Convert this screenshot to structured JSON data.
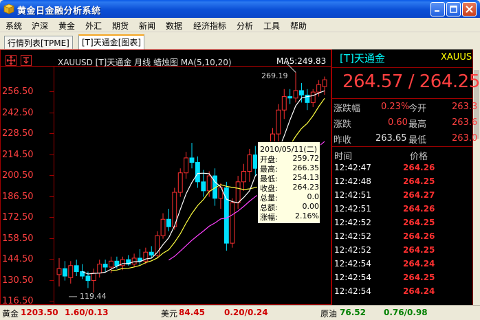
{
  "window": {
    "title": "黄金日金融分析系统"
  },
  "menu": [
    "系统",
    "沪深",
    "黄金",
    "外汇",
    "期货",
    "新闻",
    "数据",
    "经济指标",
    "分析",
    "工具",
    "帮助"
  ],
  "tabs": [
    {
      "label": "行情列表[TPME]",
      "active": false
    },
    {
      "label": "[T]天通金[图表]",
      "active": true
    }
  ],
  "chart": {
    "header": "XAUUSD [T]天通金  月线  蜡烛图  MA(5,10,20)",
    "ma5_label": "MA5:249.83",
    "high_label": "269.19",
    "low_label": "119.44",
    "colors": {
      "up": "#ff3030",
      "down": "#00e0ff",
      "ma5": "#ffffff",
      "ma10": "#ffff40",
      "ma20": "#ff40ff",
      "axis": "#a00000"
    },
    "y_labels": [
      "256.50",
      "242.50",
      "228.50",
      "214.50",
      "200.50",
      "186.50",
      "172.50",
      "158.50",
      "144.50",
      "130.50",
      "116.50"
    ]
  },
  "chart_data": {
    "type": "candlestick",
    "title": "XAUUSD [T]天通金 月线 蜡烛图 MA(5,10,20)",
    "ylim": [
      116.5,
      270
    ],
    "candles": [
      {
        "o": 134,
        "h": 145,
        "l": 126,
        "c": 138
      },
      {
        "o": 138,
        "h": 143,
        "l": 130,
        "c": 133
      },
      {
        "o": 132,
        "h": 143,
        "l": 128,
        "c": 140
      },
      {
        "o": 140,
        "h": 144,
        "l": 133,
        "c": 136
      },
      {
        "o": 136,
        "h": 141,
        "l": 131,
        "c": 133
      },
      {
        "o": 133,
        "h": 136,
        "l": 125,
        "c": 130
      },
      {
        "o": 130,
        "h": 138,
        "l": 122,
        "c": 135
      },
      {
        "o": 135,
        "h": 144,
        "l": 132,
        "c": 141
      },
      {
        "o": 141,
        "h": 144,
        "l": 136,
        "c": 139
      },
      {
        "o": 139,
        "h": 146,
        "l": 135,
        "c": 143
      },
      {
        "o": 143,
        "h": 146,
        "l": 138,
        "c": 140
      },
      {
        "o": 140,
        "h": 146,
        "l": 137,
        "c": 144
      },
      {
        "o": 144,
        "h": 147,
        "l": 140,
        "c": 141
      },
      {
        "o": 141,
        "h": 148,
        "l": 139,
        "c": 145
      },
      {
        "o": 145,
        "h": 151,
        "l": 140,
        "c": 143
      },
      {
        "o": 143,
        "h": 152,
        "l": 141,
        "c": 149
      },
      {
        "o": 149,
        "h": 153,
        "l": 145,
        "c": 147
      },
      {
        "o": 147,
        "h": 163,
        "l": 145,
        "c": 160
      },
      {
        "o": 160,
        "h": 175,
        "l": 158,
        "c": 171
      },
      {
        "o": 171,
        "h": 178,
        "l": 163,
        "c": 166
      },
      {
        "o": 166,
        "h": 192,
        "l": 164,
        "c": 189
      },
      {
        "o": 189,
        "h": 205,
        "l": 186,
        "c": 202
      },
      {
        "o": 202,
        "h": 216,
        "l": 198,
        "c": 212
      },
      {
        "o": 212,
        "h": 222,
        "l": 205,
        "c": 209
      },
      {
        "o": 209,
        "h": 213,
        "l": 192,
        "c": 196
      },
      {
        "o": 196,
        "h": 204,
        "l": 186,
        "c": 190
      },
      {
        "o": 190,
        "h": 203,
        "l": 186,
        "c": 200
      },
      {
        "o": 200,
        "h": 205,
        "l": 180,
        "c": 185
      },
      {
        "o": 185,
        "h": 195,
        "l": 178,
        "c": 192
      },
      {
        "o": 192,
        "h": 196,
        "l": 150,
        "c": 155
      },
      {
        "o": 155,
        "h": 185,
        "l": 152,
        "c": 182
      },
      {
        "o": 182,
        "h": 200,
        "l": 178,
        "c": 196
      },
      {
        "o": 196,
        "h": 208,
        "l": 190,
        "c": 203
      },
      {
        "o": 203,
        "h": 218,
        "l": 196,
        "c": 214
      },
      {
        "o": 214,
        "h": 220,
        "l": 200,
        "c": 205
      },
      {
        "o": 205,
        "h": 212,
        "l": 196,
        "c": 199
      },
      {
        "o": 199,
        "h": 214,
        "l": 196,
        "c": 210
      },
      {
        "o": 210,
        "h": 232,
        "l": 207,
        "c": 228
      },
      {
        "o": 228,
        "h": 248,
        "l": 222,
        "c": 244
      },
      {
        "o": 244,
        "h": 258,
        "l": 238,
        "c": 253
      },
      {
        "o": 253,
        "h": 258,
        "l": 248,
        "c": 252
      },
      {
        "o": 252,
        "h": 269.19,
        "l": 249,
        "c": 257
      },
      {
        "o": 257,
        "h": 262,
        "l": 249,
        "c": 254
      },
      {
        "o": 254,
        "h": 258,
        "l": 244,
        "c": 249
      },
      {
        "o": 249,
        "h": 258,
        "l": 246,
        "c": 256
      },
      {
        "o": 256,
        "h": 264,
        "l": 253,
        "c": 261
      },
      {
        "o": 259.72,
        "h": 266.35,
        "l": 254.13,
        "c": 264.23
      }
    ]
  },
  "tooltip": {
    "date": "2010/05/11(二)",
    "rows": [
      {
        "label": "开盘:",
        "value": "259.72"
      },
      {
        "label": "最高:",
        "value": "266.35"
      },
      {
        "label": "最低:",
        "value": "254.13"
      },
      {
        "label": "收盘:",
        "value": "264.23"
      },
      {
        "label": "总量:",
        "value": "0.0"
      },
      {
        "label": "总额:",
        "value": "0.00"
      },
      {
        "label": "涨幅:",
        "value": "2.16%"
      }
    ]
  },
  "quote": {
    "title": "[T]天通金",
    "code": "XAUUS",
    "price": "264.57 / 264.25",
    "rows": [
      {
        "l1": "涨跌幅",
        "v1": "0.23%",
        "l2": "今开",
        "v2": "263.3"
      },
      {
        "l1": "涨跌",
        "v1": "0.60",
        "l2": "最高",
        "v2": "263.6"
      },
      {
        "l1": "昨收",
        "v1": "263.65",
        "l2": "最低",
        "v2": "263.0"
      }
    ],
    "ticks_header": {
      "time": "时间",
      "price": "价格"
    },
    "ticks": [
      {
        "time": "12:42:47",
        "price": "264.26"
      },
      {
        "time": "12:42:48",
        "price": "264.25"
      },
      {
        "time": "12:42:51",
        "price": "264.27"
      },
      {
        "time": "12:42:51",
        "price": "264.26"
      },
      {
        "time": "12:42:52",
        "price": "264.25"
      },
      {
        "time": "12:42:52",
        "price": "264.26"
      },
      {
        "time": "12:42:52",
        "price": "264.25"
      },
      {
        "time": "12:42:54",
        "price": "264.24"
      },
      {
        "time": "12:42:54",
        "price": "264.25"
      },
      {
        "time": "12:42:54",
        "price": "264.24"
      }
    ]
  },
  "status": {
    "gold_label": "黄金",
    "gold_price": "1203.50",
    "gold_change": "1.60/0.13",
    "usd_label": "美元",
    "usd_price": "84.45",
    "usd_change": "0.20/0.24",
    "oil_label": "原油",
    "oil_price": "76.52",
    "oil_change": "0.76/0.98"
  }
}
